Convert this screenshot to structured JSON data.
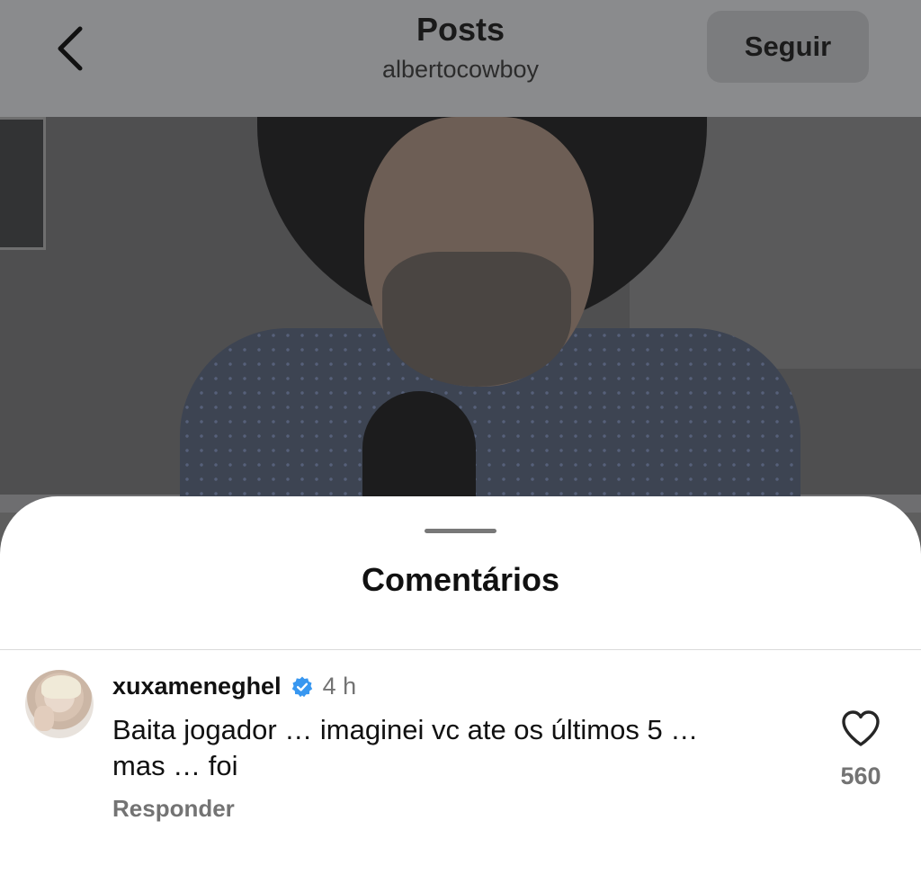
{
  "header": {
    "title": "Posts",
    "subtitle": "albertocowboy",
    "follow_label": "Seguir"
  },
  "icons": {
    "back": "chevron-left-icon",
    "verified": "verified-badge-icon",
    "like": "heart-outline-icon"
  },
  "colors": {
    "verified": "#3897f0",
    "secondary_text": "#737373"
  },
  "comments_sheet": {
    "title": "Comentários",
    "comments": [
      {
        "username": "xuxameneghel",
        "verified": true,
        "time": "4 h",
        "text_line1": "Baita jogador … imaginei vc ate os  últimos 5 …",
        "text_line2": "mas … foi",
        "reply_label": "Responder",
        "likes": "560"
      }
    ]
  }
}
